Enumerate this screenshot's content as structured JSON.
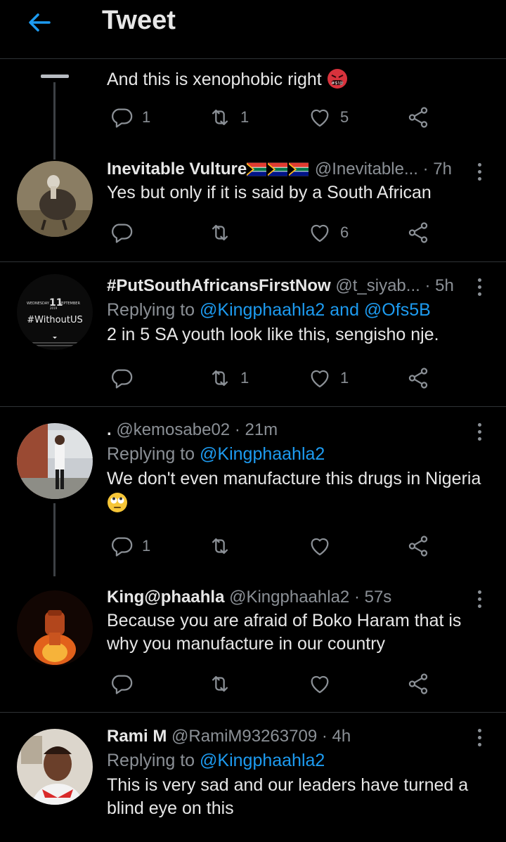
{
  "header": {
    "title": "Tweet"
  },
  "tweets": [
    {
      "body": "And this is xenophobic right",
      "emoji": "angry-face-with-symbols",
      "reply_count": "1",
      "retweet_count": "1",
      "like_count": "5"
    },
    {
      "name": "Inevitable Vulture",
      "name_flags": "south-africa-flag x3",
      "handle": "@Inevitable...",
      "time": "· 7h",
      "body": "Yes but only if it is said by a South African",
      "reply_count": "",
      "retweet_count": "",
      "like_count": "6"
    },
    {
      "name": "#PutSouthAfricansFirstNow",
      "handle": "@t_siyab...",
      "time": "· 5h",
      "replying_prefix": "Replying to ",
      "replying_to": "@Kingphaahla2 and @Ofs5B",
      "body": "2 in 5 SA youth look like this, sengisho nje.",
      "avatar_text": {
        "date_left": "WEDNESDAY",
        "date_num": "11",
        "date_right": "SEPTEMBER",
        "year": "2019",
        "brand": "#WithoutUS"
      },
      "reply_count": "",
      "retweet_count": "1",
      "like_count": "1"
    },
    {
      "name": ".",
      "handle": "@kemosabe02",
      "time": "· 21m",
      "replying_prefix": "Replying to ",
      "replying_to": "@Kingphaahla2",
      "body": "We don't even manufacture this drugs in Nigeria",
      "emoji": "face-with-rolling-eyes",
      "reply_count": "1",
      "retweet_count": "",
      "like_count": ""
    },
    {
      "name": "King@phaahla",
      "handle": "@Kingphaahla2",
      "time": "· 57s",
      "body": "Because you are afraid of Boko Haram that is why you manufacture in our country",
      "reply_count": "",
      "retweet_count": "",
      "like_count": ""
    },
    {
      "name": "Rami M",
      "handle": "@RamiM93263709",
      "time": "· 4h",
      "replying_prefix": "Replying to ",
      "replying_to": "@Kingphaahla2",
      "body": "This is very sad and our leaders have turned a blind eye on this"
    }
  ],
  "icons": [
    "back-arrow-icon",
    "reply-icon",
    "retweet-icon",
    "like-icon",
    "share-icon",
    "more-icon"
  ],
  "colors": {
    "background": "#000000",
    "accent": "#1d9bf0",
    "text": "#e7e7e7",
    "muted": "#8b9096",
    "divider": "#2f3336"
  }
}
